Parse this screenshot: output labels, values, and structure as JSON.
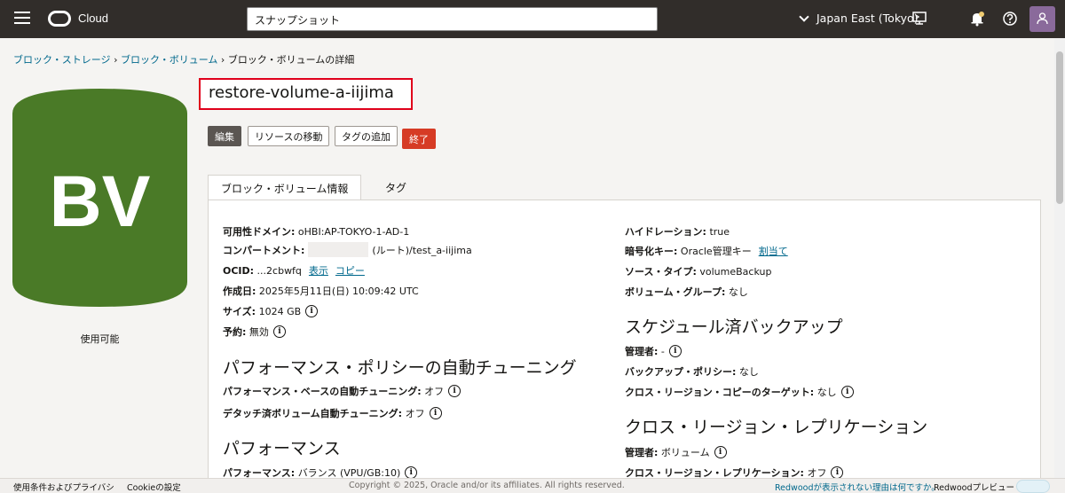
{
  "header": {
    "logo_text": "Cloud",
    "search_value": "スナップショット",
    "region": "Japan East (Tokyo)"
  },
  "breadcrumb": {
    "item1": "ブロック・ストレージ",
    "item2": "ブロック・ボリューム",
    "current": "ブロック・ボリュームの詳細",
    "sep": "›"
  },
  "resource": {
    "icon_letters": "BV",
    "icon_color": "#4a7a27",
    "status": "使用可能",
    "title": "restore-volume-a-iijima"
  },
  "actions": {
    "edit": "編集",
    "move": "リソースの移動",
    "add_tag": "タグの追加",
    "terminate": "終了"
  },
  "tabs": {
    "info": "ブロック・ボリューム情報",
    "tags": "タグ"
  },
  "left": {
    "ad_label": "可用性ドメイン:",
    "ad_value": "oHBI:AP-TOKYO-1-AD-1",
    "compartment_label": "コンパートメント:",
    "compartment_value": "(ルート)/test_a-iijima",
    "ocid_label": "OCID:",
    "ocid_value": "...2cbwfq",
    "ocid_show": "表示",
    "ocid_copy": "コピー",
    "created_label": "作成日:",
    "created_value": "2025年5月11日(日) 10:09:42 UTC",
    "size_label": "サイズ:",
    "size_value": "1024 GB",
    "reservation_label": "予約:",
    "reservation_value": "無効",
    "perf_tuning_heading": "パフォーマンス・ポリシーの自動チューニング",
    "perf_based_label": "パフォーマンス・ベースの自動チューニング:",
    "perf_based_value": "オフ",
    "detached_label": "デタッチ済ボリューム自動チューニング:",
    "detached_value": "オフ",
    "perf_heading": "パフォーマンス",
    "perf_label": "パフォーマンス:",
    "perf_value": "バランス (VPU/GB:10)"
  },
  "right": {
    "hydration_label": "ハイドレーション:",
    "hydration_value": "true",
    "encryption_label": "暗号化キー:",
    "encryption_value": "Oracle管理キー",
    "encryption_link": "割当て",
    "source_type_label": "ソース・タイプ:",
    "source_type_value": "volumeBackup",
    "volume_group_label": "ボリューム・グループ:",
    "volume_group_value": "なし",
    "sched_heading": "スケジュール済バックアップ",
    "admin_label": "管理者:",
    "admin_value": "-",
    "backup_policy_label": "バックアップ・ポリシー:",
    "backup_policy_value": "なし",
    "cross_copy_label": "クロス・リージョン・コピーのターゲット:",
    "cross_copy_value": "なし",
    "repl_heading": "クロス・リージョン・レプリケーション",
    "repl_admin_label": "管理者:",
    "repl_admin_value": "ボリューム",
    "repl_label": "クロス・リージョン・レプリケーション:",
    "repl_value": "オフ"
  },
  "footer": {
    "terms": "使用条件およびプライバシ",
    "cookie": "Cookieの設定",
    "copyright": "Copyright © 2025, Oracle and/or its affiliates. All rights reserved.",
    "redwood_why": "Redwoodが表示されない理由は何ですか。",
    "redwood_preview": "Redwoodプレビュー"
  }
}
